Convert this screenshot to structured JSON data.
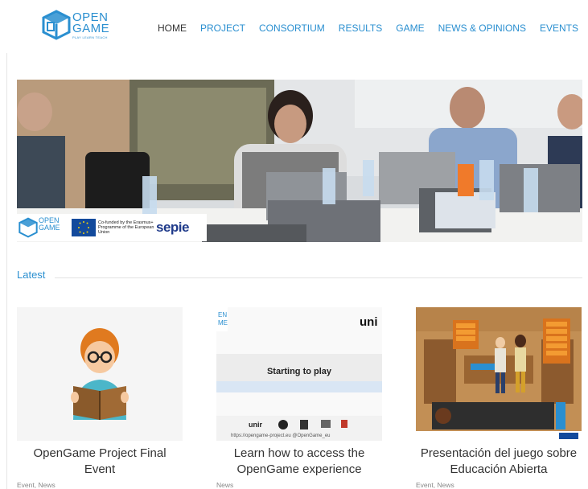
{
  "header": {
    "logo": {
      "word_line1": "OPEN",
      "word_line2": "GAME",
      "tagline": "PLAY LEARN TEACH"
    },
    "nav": [
      {
        "label": "HOME",
        "active": true
      },
      {
        "label": "PROJECT",
        "active": false
      },
      {
        "label": "CONSORTIUM",
        "active": false
      },
      {
        "label": "RESULTS",
        "active": false
      },
      {
        "label": "GAME",
        "active": false
      },
      {
        "label": "NEWS & OPINIONS",
        "active": false
      },
      {
        "label": "EVENTS",
        "active": false
      }
    ],
    "search_icon": "search-icon"
  },
  "hero": {
    "funding": {
      "logo_line1": "OPEN",
      "logo_line2": "GAME",
      "text": "Co-funded by the Erasmus+ Programme of the European Union",
      "partner": "sepie"
    }
  },
  "latest": {
    "title": "Latest",
    "posts": [
      {
        "title": "OpenGame Project Final Event",
        "meta": "Event, News"
      },
      {
        "title": "Learn how to access the OpenGame experience",
        "meta": "News",
        "thumb_text": "Starting to play",
        "thumb_brand": "uni",
        "thumb_url": "https://opengame-project.eu  @OpenGame_eu",
        "thumb_logo": "unir"
      },
      {
        "title": "Presentación del juego sobre Educación Abierta",
        "meta": "Event, News"
      }
    ]
  },
  "colors": {
    "accent": "#2a8fd0",
    "text": "#333333",
    "meta": "#888888"
  }
}
